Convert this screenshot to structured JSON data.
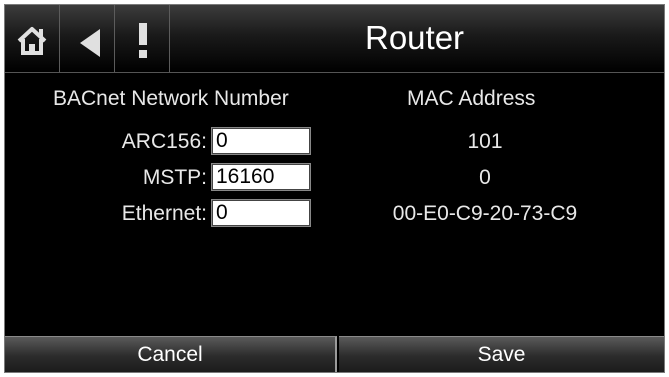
{
  "header": {
    "title": "Router",
    "icons": [
      "home-icon",
      "back-arrow-icon",
      "alert-icon"
    ]
  },
  "columns": {
    "network_number_header": "BACnet Network Number",
    "mac_header": "MAC Address"
  },
  "rows": [
    {
      "label": "ARC156:",
      "network_number": "0",
      "mac": "101"
    },
    {
      "label": "MSTP:",
      "network_number": "16160",
      "mac": "0"
    },
    {
      "label": "Ethernet:",
      "network_number": "0",
      "mac": "00-E0-C9-20-73-C9"
    }
  ],
  "footer": {
    "cancel_label": "Cancel",
    "save_label": "Save"
  }
}
